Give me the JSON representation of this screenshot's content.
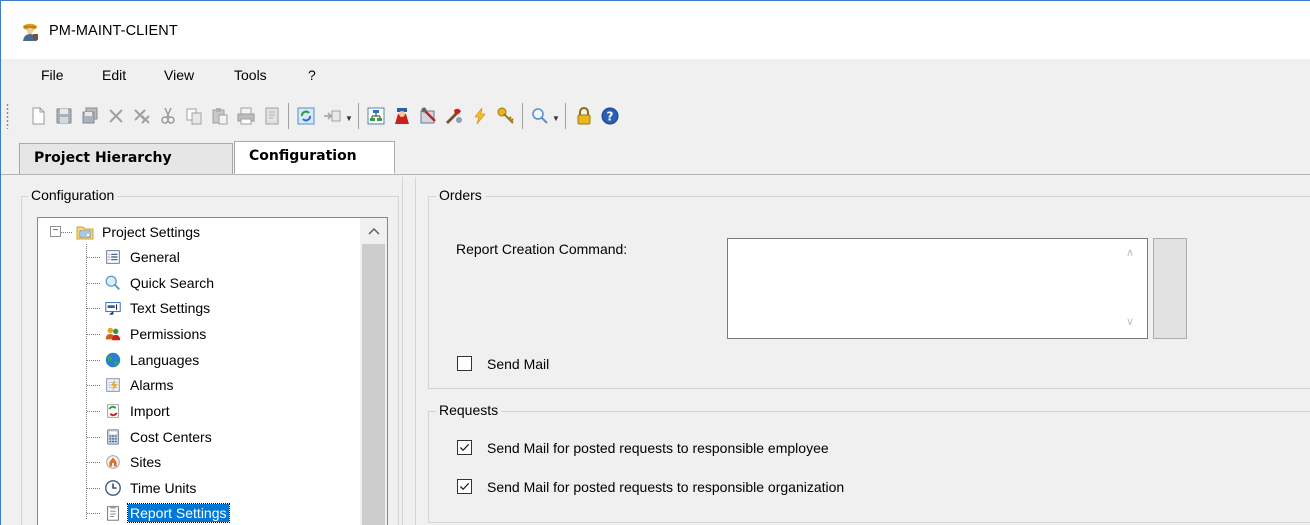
{
  "window": {
    "title": "PM-MAINT-CLIENT",
    "app_icon": "worker-icon"
  },
  "menu": {
    "items": [
      "File",
      "Edit",
      "View",
      "Tools",
      "?"
    ]
  },
  "toolbar": {
    "buttons": [
      "new-icon",
      "save-icon",
      "save-all-icon",
      "delete-icon",
      "delete-multiple-icon",
      "cut-icon",
      "copy-icon",
      "paste-icon",
      "print-icon",
      "preview-icon",
      "refresh-icon",
      "insert-icon",
      "structure-icon",
      "users-icon",
      "settings-icon",
      "tools-icon",
      "flash-icon",
      "key-icon",
      "search-icon",
      "lock-icon",
      "help-icon"
    ]
  },
  "tabs": [
    {
      "label": "Project Hierarchy",
      "active": false
    },
    {
      "label": "Configuration",
      "active": true
    }
  ],
  "left_panel": {
    "group_title": "Configuration",
    "tree": {
      "root": {
        "label": "Project Settings",
        "expanded": true,
        "icon": "folder-icon"
      },
      "children": [
        {
          "label": "General",
          "icon": "list-icon"
        },
        {
          "label": "Quick Search",
          "icon": "magnifier-icon"
        },
        {
          "label": "Text Settings",
          "icon": "text-icon"
        },
        {
          "label": "Permissions",
          "icon": "people-icon"
        },
        {
          "label": "Languages",
          "icon": "globe-icon"
        },
        {
          "label": "Alarms",
          "icon": "alarm-icon"
        },
        {
          "label": "Import",
          "icon": "import-icon"
        },
        {
          "label": "Cost Centers",
          "icon": "calculator-icon"
        },
        {
          "label": "Sites",
          "icon": "sites-icon"
        },
        {
          "label": "Time Units",
          "icon": "clock-icon"
        },
        {
          "label": "Report Settings",
          "icon": "report-icon",
          "selected": true
        }
      ]
    }
  },
  "orders": {
    "group_title": "Orders",
    "report_command_label": "Report Creation Command:",
    "report_command_value": "",
    "send_mail_label": "Send Mail",
    "send_mail_checked": false
  },
  "requests": {
    "group_title": "Requests",
    "mail_employee_label": "Send Mail for posted requests to responsible employee",
    "mail_employee_checked": true,
    "mail_org_label": "Send Mail for posted requests to responsible organization",
    "mail_org_checked": true
  },
  "colors": {
    "selection": "#0078d7",
    "window_border": "#3d7cc9"
  }
}
